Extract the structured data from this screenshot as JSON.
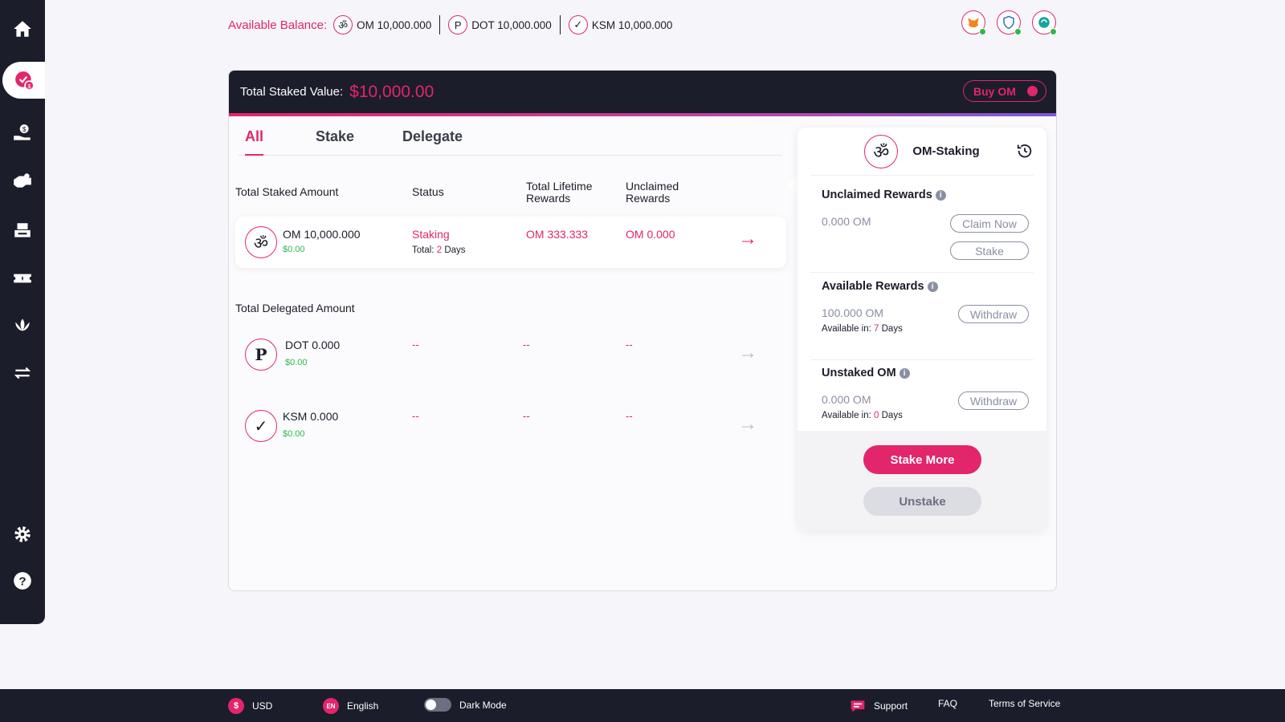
{
  "colors": {
    "accent": "#e3256b",
    "dark": "#1b1d2a",
    "green": "#2cb84b",
    "muted": "#8a8fa3"
  },
  "sidebar": {
    "items": [
      {
        "icon": "home-icon"
      },
      {
        "icon": "staking-icon",
        "active": true
      },
      {
        "icon": "lending-icon"
      },
      {
        "icon": "delegate-icon"
      },
      {
        "icon": "printer-icon"
      },
      {
        "icon": "ticket-icon"
      },
      {
        "icon": "lotus-icon"
      },
      {
        "icon": "swap-icon"
      },
      {
        "icon": "settings-icon"
      },
      {
        "icon": "help-icon"
      }
    ]
  },
  "balance": {
    "label": "Available Balance:",
    "items": [
      {
        "coin": "OM",
        "glyph": "ॐ",
        "value": "OM 10,000.000"
      },
      {
        "coin": "DOT",
        "glyph": "P",
        "value": "DOT 10,000.000"
      },
      {
        "coin": "KSM",
        "glyph": "✓",
        "value": "KSM 10,000.000"
      }
    ]
  },
  "wallets": [
    "metamask-icon",
    "shield-icon",
    "polkadot-wallet-icon"
  ],
  "header": {
    "label": "Total Staked Value:",
    "value": "$10,000.00",
    "buy_label": "Buy OM"
  },
  "tabs": [
    "All",
    "Stake",
    "Delegate"
  ],
  "columns": {
    "amount": "Total Staked Amount",
    "status": "Status",
    "lifetime": "Total Lifetime Rewards",
    "unclaimed": "Unclaimed Rewards"
  },
  "staked_row": {
    "glyph": "ॐ",
    "amount": "OM 10,000.000",
    "usd": "$0.00",
    "status": "Staking",
    "total_label": "Total:",
    "total_days": "2",
    "days_label": "Days",
    "lifetime": "OM 333.333",
    "unclaimed": "OM 0.000",
    "arrow": "→"
  },
  "delegated_label": "Total Delegated Amount",
  "delegated_rows": [
    {
      "glyph": "P",
      "amount": "DOT 0.000",
      "usd": "$0.00",
      "status": "--",
      "lifetime": "--",
      "unclaimed": "--",
      "arrow": "→"
    },
    {
      "glyph": "✓",
      "amount": "KSM 0.000",
      "usd": "$0.00",
      "status": "--",
      "lifetime": "--",
      "unclaimed": "--",
      "arrow": "→"
    }
  ],
  "panel": {
    "glyph": "ॐ",
    "title": "OM-Staking",
    "unclaimed": {
      "title": "Unclaimed Rewards",
      "value": "0.000 OM",
      "claim_label": "Claim Now",
      "stake_label": "Stake"
    },
    "available": {
      "title": "Available Rewards",
      "value": "100.000 OM",
      "avail_label": "Available in:",
      "days": "7",
      "days_label": "Days",
      "withdraw_label": "Withdraw"
    },
    "unstaked": {
      "title": "Unstaked OM",
      "value": "0.000 OM",
      "avail_label": "Available in:",
      "days": "0",
      "days_label": "Days",
      "withdraw_label": "Withdraw"
    },
    "stake_more_label": "Stake More",
    "unstake_label": "Unstake"
  },
  "footer": {
    "currency_badge": "$",
    "currency": "USD",
    "lang_badge": "EN",
    "language": "English",
    "dark_mode": "Dark Mode",
    "support": "Support",
    "faq": "FAQ",
    "terms": "Terms of Service"
  }
}
